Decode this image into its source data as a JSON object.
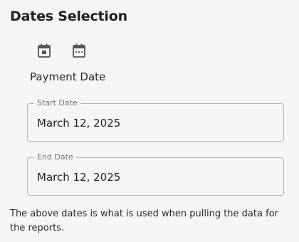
{
  "header": {
    "title": "Dates Selection"
  },
  "toolbar": {
    "icons": [
      {
        "name": "calendar-today-icon",
        "color": "#555555"
      },
      {
        "name": "calendar-range-icon",
        "color": "#555555"
      }
    ]
  },
  "section": {
    "label": "Payment Date"
  },
  "fields": {
    "start": {
      "label": "Start Date",
      "value": "March 12, 2025"
    },
    "end": {
      "label": "End Date",
      "value": "March 12, 2025"
    }
  },
  "footer": {
    "note": "The above dates is what is used when pulling the data for the reports."
  }
}
